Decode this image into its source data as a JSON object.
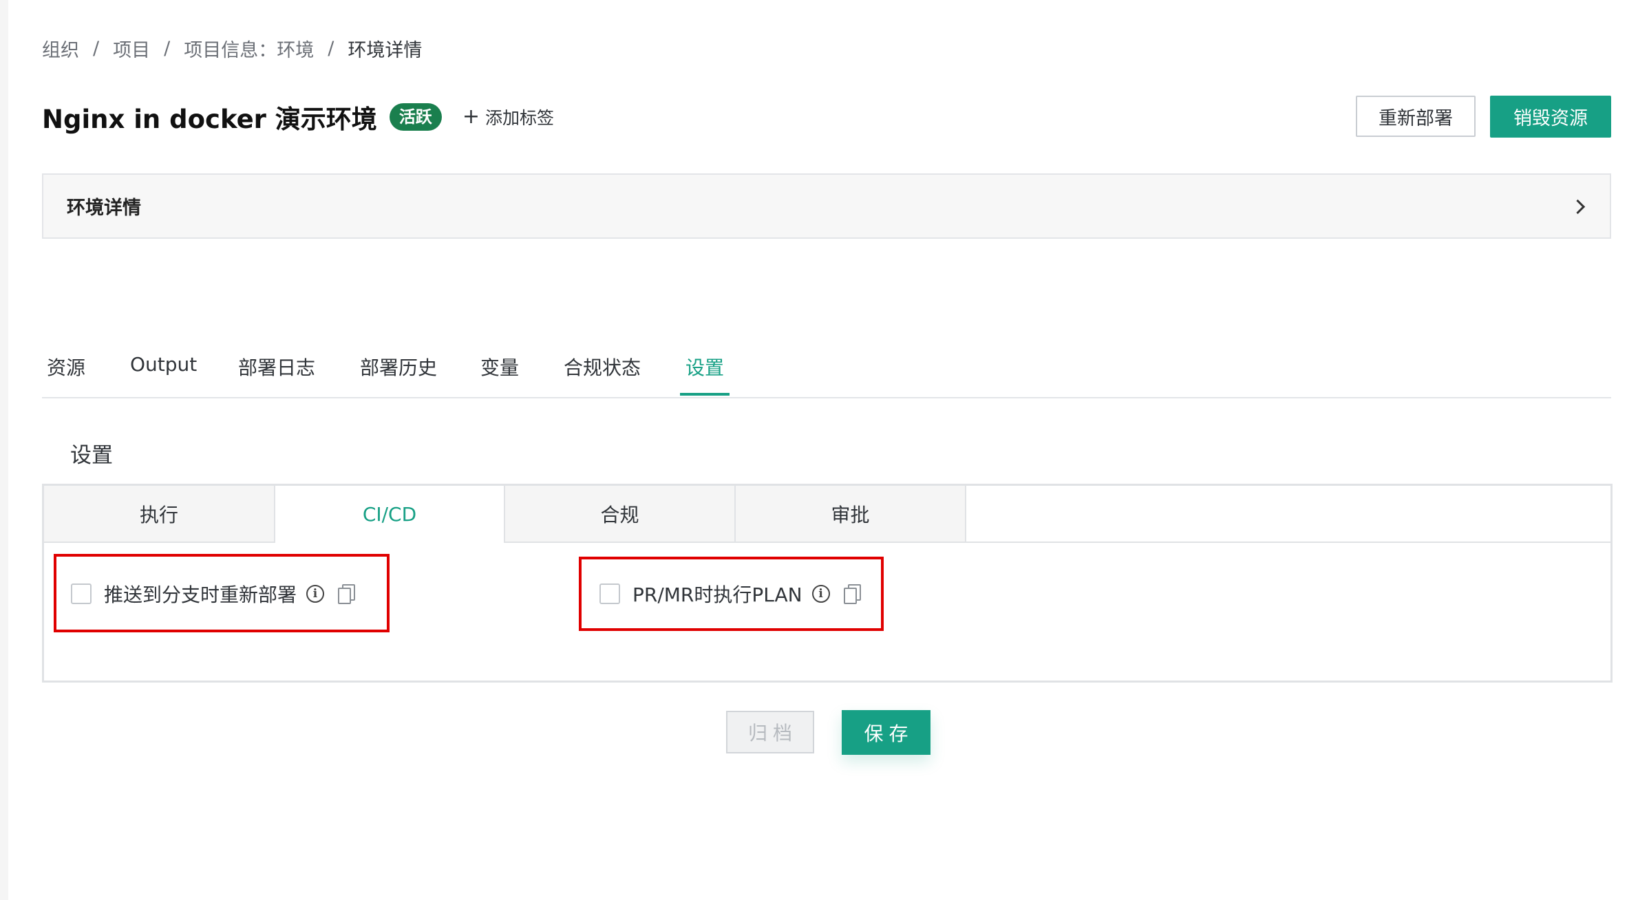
{
  "breadcrumb": {
    "items": [
      {
        "label": "组织"
      },
      {
        "label": "项目"
      },
      {
        "label": "项目信息：环境"
      },
      {
        "label": "环境详情"
      }
    ],
    "separator": "/"
  },
  "header": {
    "title": "Nginx in docker 演示环境",
    "status_badge": "活跃",
    "add_tag_label": "添加标签",
    "redeploy_label": "重新部署",
    "destroy_label": "销毁资源"
  },
  "detail_panel": {
    "label": "环境详情"
  },
  "main_tabs": {
    "items": [
      {
        "label": "资源"
      },
      {
        "label": "Output"
      },
      {
        "label": "部署日志"
      },
      {
        "label": "部署历史"
      },
      {
        "label": "变量"
      },
      {
        "label": "合规状态"
      },
      {
        "label": "设置"
      }
    ],
    "active": "设置"
  },
  "settings": {
    "title": "设置",
    "subtabs": [
      {
        "label": "执行"
      },
      {
        "label": "CI/CD"
      },
      {
        "label": "合规"
      },
      {
        "label": "审批"
      }
    ],
    "active_subtab": "CI/CD",
    "options": [
      {
        "label": "推送到分支时重新部署",
        "checked": false
      },
      {
        "label": "PR/MR时执行PLAN",
        "checked": false
      }
    ]
  },
  "footer": {
    "archive_label": "归档",
    "save_label": "保存"
  },
  "colors": {
    "accent": "#17a085",
    "badge": "#1a7f4e",
    "highlight": "#e00000"
  }
}
